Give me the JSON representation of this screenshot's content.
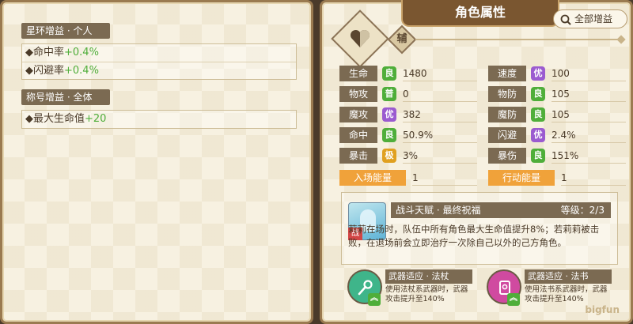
{
  "left_panel": {
    "star_ring": {
      "header": "星环增益 · 个人",
      "rows": [
        {
          "label": "◆命中率",
          "value": "+0.4%"
        },
        {
          "label": "◆闪避率",
          "value": "+0.4%"
        }
      ]
    },
    "title_buff": {
      "header": "称号增益 · 全体",
      "rows": [
        {
          "label": "◆最大生命值",
          "value": "+20"
        }
      ]
    }
  },
  "right_panel": {
    "title": "角色属性",
    "all_buffs_button": "全部增益",
    "role_badge": "辅",
    "stats": [
      {
        "label": "生命",
        "grade": "良",
        "value": "1480",
        "grade_color": "#4fae3a"
      },
      {
        "label": "速度",
        "grade": "优",
        "value": "100",
        "grade_color": "#9b5bd0"
      },
      {
        "label": "物攻",
        "grade": "普",
        "value": "0",
        "grade_color": "#4fae3a"
      },
      {
        "label": "物防",
        "grade": "良",
        "value": "105",
        "grade_color": "#4fae3a"
      },
      {
        "label": "魔攻",
        "grade": "优",
        "value": "382",
        "grade_color": "#9b5bd0"
      },
      {
        "label": "魔防",
        "grade": "良",
        "value": "105",
        "grade_color": "#4fae3a"
      },
      {
        "label": "命中",
        "grade": "良",
        "value": "50.9%",
        "grade_color": "#4fae3a"
      },
      {
        "label": "闪避",
        "grade": "优",
        "value": "2.4%",
        "grade_color": "#9b5bd0"
      },
      {
        "label": "暴击",
        "grade": "极",
        "value": "3%",
        "grade_color": "#e0a020"
      },
      {
        "label": "暴伤",
        "grade": "良",
        "value": "151%",
        "grade_color": "#4fae3a"
      }
    ],
    "entry_energy": {
      "label": "入场能量",
      "value": "1"
    },
    "action_energy": {
      "label": "行动能量",
      "value": "1"
    },
    "talent": {
      "name": "战斗天赋 · 最终祝福",
      "level": "等级：2/3",
      "tag": "战",
      "description": "莉莉在场时，队伍中所有角色最大生命值提升8%；若莉莉被击败，在退场前会立即治疗一次除自己以外的己方角色。"
    },
    "weapons": [
      {
        "title": "武器适应 · 法杖",
        "desc": "使用法杖系武器时，武器攻击提升至140%",
        "up": "︽",
        "color": "#3fb58a",
        "icon": "staff-icon"
      },
      {
        "title": "武器适应 · 法书",
        "desc": "使用法书系武器时，武器攻击提升至140%",
        "up": "︽",
        "color": "#d04aa0",
        "icon": "spellbook-icon"
      }
    ],
    "watermark": "bigfun"
  }
}
